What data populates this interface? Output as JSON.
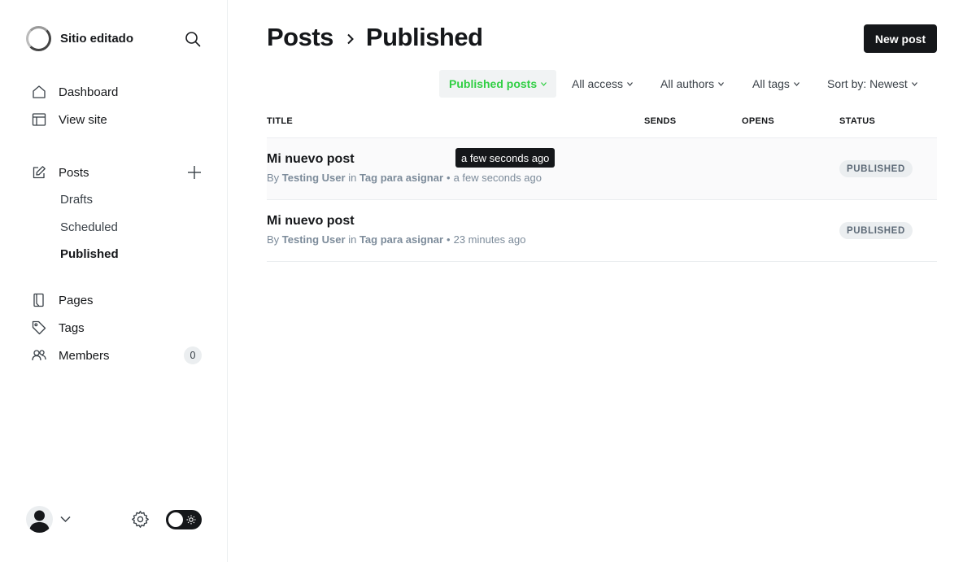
{
  "sidebar": {
    "site_name": "Sitio editado",
    "nav": {
      "dashboard": "Dashboard",
      "view_site": "View site",
      "posts": "Posts",
      "drafts": "Drafts",
      "scheduled": "Scheduled",
      "published": "Published",
      "pages": "Pages",
      "tags": "Tags",
      "members": "Members",
      "members_count": "0"
    }
  },
  "header": {
    "section": "Posts",
    "subsection": "Published",
    "new_post_label": "New post"
  },
  "filters": {
    "type": "Published posts",
    "access": "All access",
    "authors": "All authors",
    "tags": "All tags",
    "sort": "Sort by: Newest",
    "accent_color": "#30cf43"
  },
  "table": {
    "columns": {
      "title": "TITLE",
      "sends": "SENDS",
      "opens": "OPENS",
      "status": "STATUS"
    },
    "rows": [
      {
        "title": "Mi nuevo post",
        "by": "By",
        "author": "Testing User",
        "in": "in",
        "tag": "Tag para asignar",
        "time": "a few seconds ago",
        "status": "PUBLISHED"
      },
      {
        "title": "Mi nuevo post",
        "by": "By",
        "author": "Testing User",
        "in": "in",
        "tag": "Tag para asignar",
        "time": "23 minutes ago",
        "status": "PUBLISHED"
      }
    ]
  },
  "tooltip": {
    "text": "a few seconds ago"
  },
  "icons": [
    "search-icon",
    "home-icon",
    "layout-icon",
    "pencil-icon",
    "plus-icon",
    "page-icon",
    "tag-icon",
    "members-icon",
    "chevron-down-icon",
    "gear-icon",
    "sun-icon"
  ]
}
